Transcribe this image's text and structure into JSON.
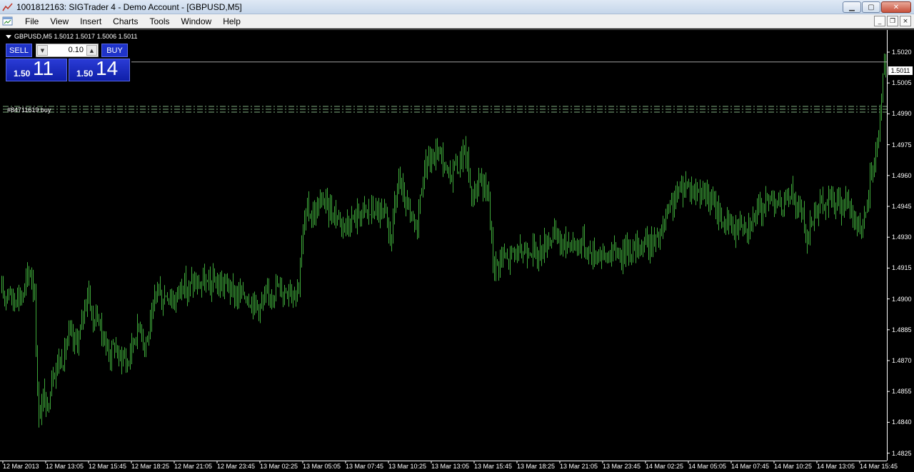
{
  "window": {
    "title": "1001812163: SIGTrader 4 - Demo Account - [GBPUSD,M5]",
    "minimize": "0",
    "maximize": "1",
    "close": "r"
  },
  "menu": {
    "items": [
      "File",
      "View",
      "Insert",
      "Charts",
      "Tools",
      "Window",
      "Help"
    ],
    "mdi_minimize": "_",
    "mdi_restore": "❐",
    "mdi_close": "×"
  },
  "chart": {
    "symbol_info": "GBPUSD,M5  1.5012 1.5017 1.5006 1.5011",
    "trade_panel": {
      "sell_label": "SELL",
      "buy_label": "BUY",
      "lot": "0.10",
      "sell_price_small": "1.50",
      "sell_price_big": "11",
      "buy_price_small": "1.50",
      "buy_price_big": "14"
    },
    "order_label": "#84711619 buy",
    "current_price": "1.5011",
    "bar_color": "#3ea83a",
    "price_line_color": "#a0a0a0",
    "order_line_color": "#7fae7f",
    "price_labels": [
      "1.5020",
      "1.5005",
      "1.4990",
      "1.4975",
      "1.4960",
      "1.4945",
      "1.4930",
      "1.4915",
      "1.4900",
      "1.4885",
      "1.4870",
      "1.4855",
      "1.4840",
      "1.4825"
    ],
    "time_labels": [
      "12 Mar 2013",
      "12 Mar 13:05",
      "12 Mar 15:45",
      "12 Mar 18:25",
      "12 Mar 21:05",
      "12 Mar 23:45",
      "13 Mar 02:25",
      "13 Mar 05:05",
      "13 Mar 07:45",
      "13 Mar 10:25",
      "13 Mar 13:05",
      "13 Mar 15:45",
      "13 Mar 18:25",
      "13 Mar 21:05",
      "13 Mar 23:45",
      "14 Mar 02:25",
      "14 Mar 05:05",
      "14 Mar 07:45",
      "14 Mar 10:25",
      "14 Mar 13:05",
      "14 Mar 15:45"
    ]
  },
  "chart_data": {
    "type": "ohlc",
    "y_range": [
      1.482,
      1.5025
    ],
    "current_price": 1.5011,
    "order_price": 1.49882,
    "close_path": [
      [
        0,
        1.49
      ],
      [
        6,
        1.4898
      ],
      [
        12,
        1.4903
      ],
      [
        18,
        1.4895
      ],
      [
        24,
        1.49
      ],
      [
        30,
        1.4897
      ],
      [
        36,
        1.4905
      ],
      [
        42,
        1.491
      ],
      [
        48,
        1.49
      ],
      [
        52,
        1.485
      ],
      [
        55,
        1.484
      ],
      [
        60,
        1.485
      ],
      [
        66,
        1.4843
      ],
      [
        72,
        1.486
      ],
      [
        80,
        1.4866
      ],
      [
        88,
        1.4868
      ],
      [
        96,
        1.488
      ],
      [
        104,
        1.4875
      ],
      [
        112,
        1.488
      ],
      [
        118,
        1.4895
      ],
      [
        124,
        1.49
      ],
      [
        130,
        1.4885
      ],
      [
        136,
        1.489
      ],
      [
        142,
        1.488
      ],
      [
        148,
        1.4875
      ],
      [
        154,
        1.487
      ],
      [
        160,
        1.4875
      ],
      [
        166,
        1.4868
      ],
      [
        172,
        1.487
      ],
      [
        178,
        1.4865
      ],
      [
        184,
        1.4875
      ],
      [
        190,
        1.488
      ],
      [
        196,
        1.4885
      ],
      [
        202,
        1.4875
      ],
      [
        208,
        1.488
      ],
      [
        214,
        1.489
      ],
      [
        220,
        1.4905
      ],
      [
        226,
        1.4895
      ],
      [
        232,
        1.49
      ],
      [
        238,
        1.4898
      ],
      [
        244,
        1.4895
      ],
      [
        250,
        1.4902
      ],
      [
        256,
        1.4905
      ],
      [
        262,
        1.49
      ],
      [
        268,
        1.4905
      ],
      [
        276,
        1.4903
      ],
      [
        284,
        1.4905
      ],
      [
        292,
        1.4903
      ],
      [
        300,
        1.4905
      ],
      [
        308,
        1.4903
      ],
      [
        316,
        1.4905
      ],
      [
        324,
        1.49
      ],
      [
        332,
        1.4898
      ],
      [
        340,
        1.49
      ],
      [
        348,
        1.4897
      ],
      [
        356,
        1.4895
      ],
      [
        364,
        1.4893
      ],
      [
        372,
        1.4897
      ],
      [
        380,
        1.49
      ],
      [
        388,
        1.4903
      ],
      [
        396,
        1.49
      ],
      [
        404,
        1.4903
      ],
      [
        412,
        1.49
      ],
      [
        418,
        1.4905
      ],
      [
        424,
        1.493
      ],
      [
        430,
        1.494
      ],
      [
        436,
        1.4937
      ],
      [
        444,
        1.494
      ],
      [
        452,
        1.4945
      ],
      [
        460,
        1.494
      ],
      [
        468,
        1.4938
      ],
      [
        476,
        1.4935
      ],
      [
        484,
        1.4933
      ],
      [
        492,
        1.4935
      ],
      [
        500,
        1.4937
      ],
      [
        508,
        1.494
      ],
      [
        516,
        1.4938
      ],
      [
        524,
        1.494
      ],
      [
        532,
        1.4938
      ],
      [
        540,
        1.4935
      ],
      [
        546,
        1.4925
      ],
      [
        552,
        1.494
      ],
      [
        558,
        1.4955
      ],
      [
        564,
        1.4945
      ],
      [
        570,
        1.494
      ],
      [
        576,
        1.4935
      ],
      [
        582,
        1.493
      ],
      [
        588,
        1.4945
      ],
      [
        594,
        1.496
      ],
      [
        600,
        1.4965
      ],
      [
        606,
        1.4962
      ],
      [
        612,
        1.497
      ],
      [
        618,
        1.4965
      ],
      [
        624,
        1.4958
      ],
      [
        630,
        1.4955
      ],
      [
        636,
        1.4963
      ],
      [
        642,
        1.496
      ],
      [
        648,
        1.4968
      ],
      [
        654,
        1.4963
      ],
      [
        660,
        1.4945
      ],
      [
        666,
        1.495
      ],
      [
        672,
        1.4955
      ],
      [
        678,
        1.495
      ],
      [
        684,
        1.4945
      ],
      [
        690,
        1.4915
      ],
      [
        696,
        1.4913
      ],
      [
        702,
        1.4918
      ],
      [
        710,
        1.4915
      ],
      [
        718,
        1.492
      ],
      [
        726,
        1.4918
      ],
      [
        734,
        1.492
      ],
      [
        742,
        1.4922
      ],
      [
        750,
        1.4918
      ],
      [
        758,
        1.492
      ],
      [
        766,
        1.4925
      ],
      [
        774,
        1.4928
      ],
      [
        782,
        1.4925
      ],
      [
        790,
        1.4923
      ],
      [
        798,
        1.4925
      ],
      [
        806,
        1.4922
      ],
      [
        814,
        1.4925
      ],
      [
        822,
        1.492
      ],
      [
        830,
        1.4918
      ],
      [
        838,
        1.492
      ],
      [
        846,
        1.4917
      ],
      [
        854,
        1.4918
      ],
      [
        862,
        1.492
      ],
      [
        870,
        1.4918
      ],
      [
        878,
        1.4922
      ],
      [
        886,
        1.492
      ],
      [
        894,
        1.4922
      ],
      [
        902,
        1.4925
      ],
      [
        910,
        1.4923
      ],
      [
        918,
        1.4925
      ],
      [
        926,
        1.4928
      ],
      [
        932,
        1.4935
      ],
      [
        938,
        1.494
      ],
      [
        944,
        1.4945
      ],
      [
        950,
        1.4948
      ],
      [
        956,
        1.495
      ],
      [
        962,
        1.4953
      ],
      [
        968,
        1.495
      ],
      [
        974,
        1.4948
      ],
      [
        980,
        1.495
      ],
      [
        986,
        1.4947
      ],
      [
        992,
        1.4945
      ],
      [
        998,
        1.4942
      ],
      [
        1004,
        1.494
      ],
      [
        1010,
        1.4935
      ],
      [
        1016,
        1.4932
      ],
      [
        1022,
        1.4933
      ],
      [
        1028,
        1.493
      ],
      [
        1034,
        1.4933
      ],
      [
        1040,
        1.4935
      ],
      [
        1046,
        1.4932
      ],
      [
        1052,
        1.4935
      ],
      [
        1058,
        1.4937
      ],
      [
        1064,
        1.494
      ],
      [
        1070,
        1.4942
      ],
      [
        1076,
        1.4945
      ],
      [
        1082,
        1.4947
      ],
      [
        1088,
        1.4943
      ],
      [
        1094,
        1.494
      ],
      [
        1100,
        1.4943
      ],
      [
        1106,
        1.495
      ],
      [
        1112,
        1.4945
      ],
      [
        1118,
        1.494
      ],
      [
        1124,
        1.4935
      ],
      [
        1130,
        1.4925
      ],
      [
        1136,
        1.4935
      ],
      [
        1142,
        1.494
      ],
      [
        1148,
        1.4943
      ],
      [
        1154,
        1.494
      ],
      [
        1160,
        1.4945
      ],
      [
        1166,
        1.4943
      ],
      [
        1172,
        1.4945
      ],
      [
        1178,
        1.494
      ],
      [
        1184,
        1.4943
      ],
      [
        1190,
        1.494
      ],
      [
        1196,
        1.4935
      ],
      [
        1202,
        1.4933
      ],
      [
        1208,
        1.493
      ],
      [
        1214,
        1.494
      ],
      [
        1218,
        1.4955
      ],
      [
        1222,
        1.496
      ],
      [
        1226,
        1.4968
      ],
      [
        1230,
        1.4978
      ],
      [
        1234,
        1.4995
      ],
      [
        1236,
        1.5005
      ],
      [
        1238,
        1.5012
      ],
      [
        1240,
        1.5011
      ]
    ]
  }
}
